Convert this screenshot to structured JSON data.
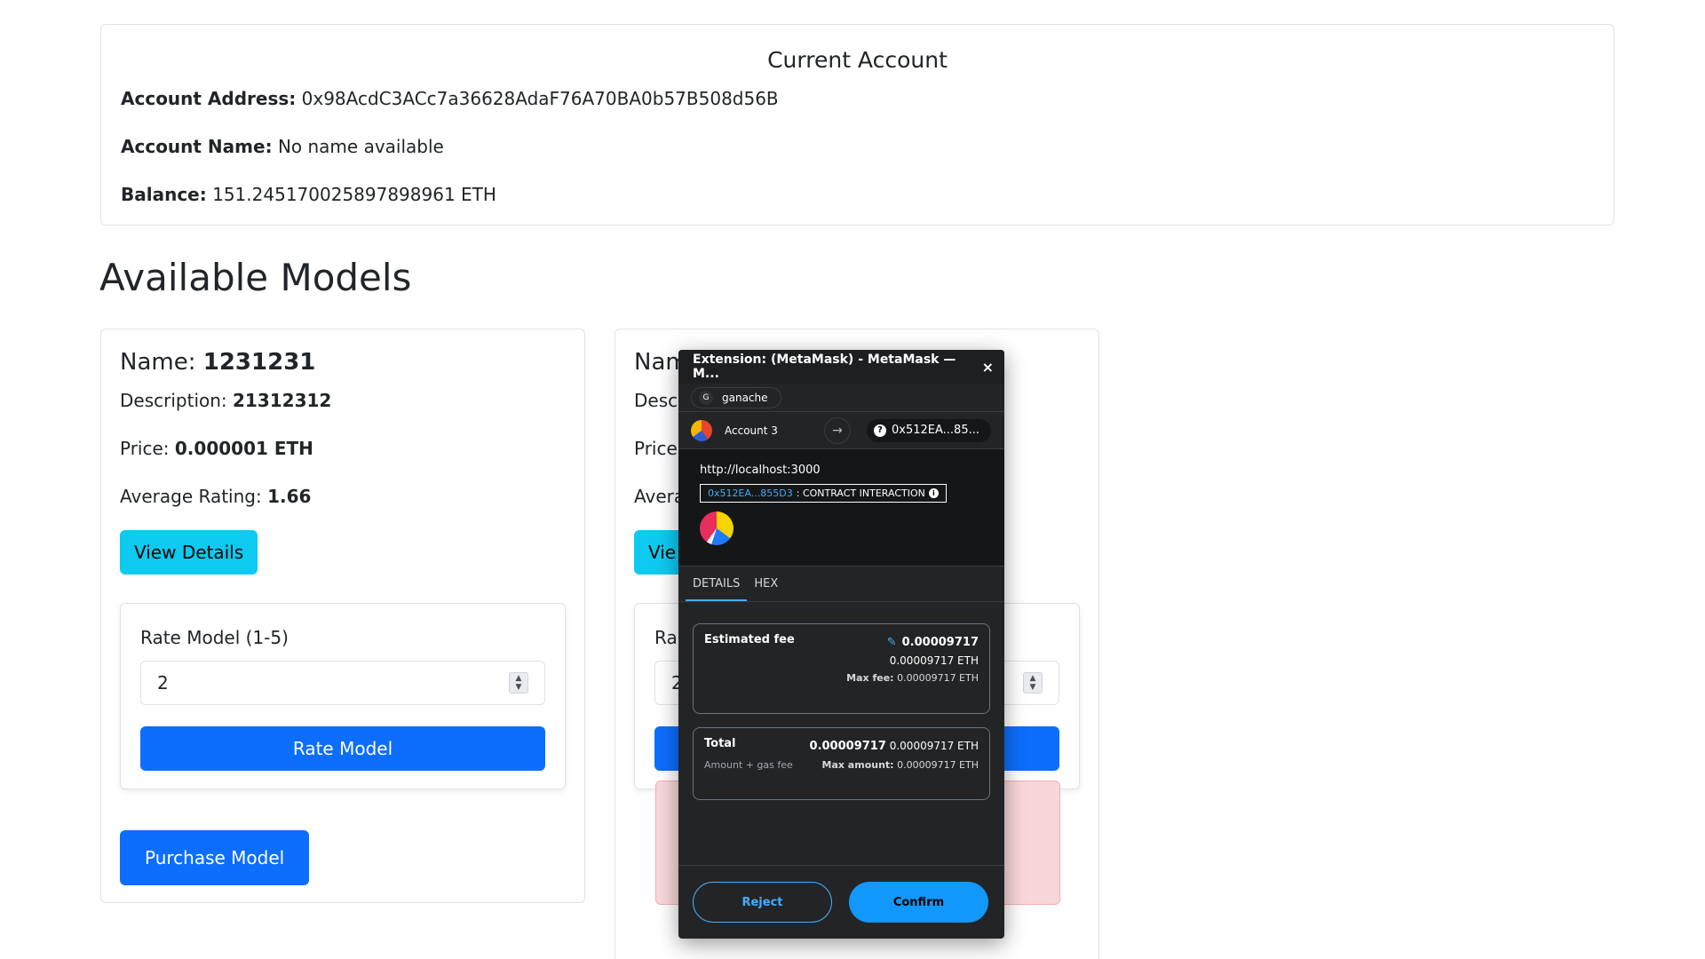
{
  "account": {
    "title": "Current Account",
    "address_label": "Account Address:",
    "address_value": "0x98AcdC3ACc7a36628AdaF76A70BA0b57B508d56B",
    "name_label": "Account Name:",
    "name_value": "No name available",
    "balance_label": "Balance:",
    "balance_value": "151.245170025897898961 ETH"
  },
  "models_title": "Available Models",
  "model_card_1": {
    "name_label": "Name:",
    "name_value": "1231231",
    "description_label": "Description:",
    "description_value": "21312312",
    "price_label": "Price:",
    "price_value": "0.000001 ETH",
    "rating_label": "Average Rating:",
    "rating_value": "1.66",
    "view_details": "View Details",
    "rate_label": "Rate Model (1-5)",
    "rate_value": "2",
    "rate_button": "Rate Model",
    "purchase_button": "Purchase Model"
  },
  "model_card_2": {
    "name_partial": "Nam",
    "description_partial": "Desc",
    "price_partial": "Price",
    "rating_partial": "Avera",
    "view_partial": "Vie",
    "rate_partial": "Ra",
    "rate_value_partial": "2"
  },
  "metamask": {
    "window_title": "Extension: (MetaMask) - MetaMask — M...",
    "close": "×",
    "network": "ganache",
    "network_initial": "G",
    "account_name": "Account 3",
    "destination": "0x512EA...85...",
    "origin": "http://localhost:3000",
    "contract_address": "0x512EA...855D3",
    "contract_label": ": CONTRACT INTERACTION",
    "tabs": [
      "DETAILS",
      "HEX"
    ],
    "estimated_fee_label": "Estimated fee",
    "estimated_fee_value": "0.00009717",
    "estimated_fee_eth": "0.00009717 ETH",
    "max_fee_label": "Max fee:",
    "max_fee_value": "0.00009717 ETH",
    "total_label": "Total",
    "total_value": "0.00009717",
    "total_eth": "0.00009717 ETH",
    "amount_gas_label": "Amount + gas fee",
    "max_amount_label": "Max amount:",
    "max_amount_value": "0.00009717 ETH",
    "reject": "Reject",
    "confirm": "Confirm"
  }
}
